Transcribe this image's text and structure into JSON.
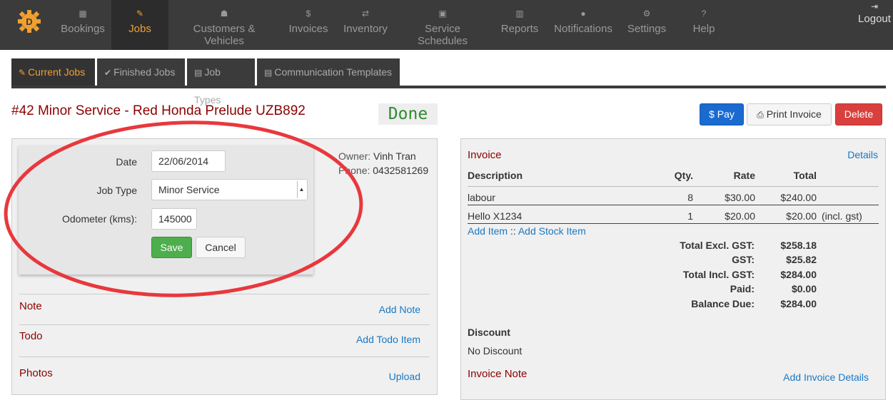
{
  "nav": {
    "items": [
      {
        "label": "Bookings",
        "icon": "calendar-icon",
        "glyph": "▦"
      },
      {
        "label": "Jobs",
        "icon": "wrench-icon",
        "glyph": "✎"
      },
      {
        "label": "Customers & Vehicles",
        "icon": "users-icon",
        "glyph": "☗"
      },
      {
        "label": "Invoices",
        "icon": "dollar-icon",
        "glyph": "$"
      },
      {
        "label": "Inventory",
        "icon": "exchange-icon",
        "glyph": "⇄"
      },
      {
        "label": "Service Schedules",
        "icon": "calendar-small-icon",
        "glyph": "▣"
      },
      {
        "label": "Reports",
        "icon": "bar-chart-icon",
        "glyph": "▥"
      },
      {
        "label": "Notifications",
        "icon": "info-icon",
        "glyph": "●"
      },
      {
        "label": "Settings",
        "icon": "cogs-icon",
        "glyph": "⚙"
      },
      {
        "label": "Help",
        "icon": "question-icon",
        "glyph": "?"
      }
    ],
    "logout": {
      "label": "Logout",
      "glyph": "⇥"
    },
    "active_color": "#f0a030"
  },
  "tabs": [
    {
      "label": "Current Jobs",
      "glyph": "✎"
    },
    {
      "label": "Finished Jobs",
      "glyph": "✔"
    },
    {
      "label": "Job Types",
      "glyph": "▤"
    },
    {
      "label": "Communication Templates",
      "glyph": "▤"
    }
  ],
  "job": {
    "title": "#42 Minor Service - Red Honda Prelude UZB892",
    "status": "Done"
  },
  "actions": {
    "pay": "$ Pay",
    "print": "Print Invoice",
    "delete": "Delete"
  },
  "form": {
    "date_label": "Date",
    "date_value": "22/06/2014",
    "job_type_label": "Job Type",
    "job_type_value": "Minor Service",
    "odometer_label": "Odometer (kms):",
    "odometer_value": "145000",
    "save": "Save",
    "cancel": "Cancel"
  },
  "owner": {
    "owner_key": "Owner:",
    "owner_name": "Vinh Tran",
    "phone_key": "Phone:",
    "phone": "0432581269"
  },
  "sections": {
    "note": "Note",
    "note_link": "Add Note",
    "todo": "Todo",
    "todo_link": "Add Todo Item",
    "photos": "Photos",
    "photos_link": "Upload"
  },
  "invoice": {
    "title": "Invoice",
    "details_link": "Details",
    "headers": {
      "description": "Description",
      "qty": "Qty.",
      "rate": "Rate",
      "total": "Total"
    },
    "rows": [
      {
        "description": "labour",
        "qty": "8",
        "rate": "$30.00",
        "total": "$240.00",
        "note": ""
      },
      {
        "description": "Hello X1234",
        "qty": "1",
        "rate": "$20.00",
        "total": "$20.00",
        "note": "(incl. gst)"
      }
    ],
    "add_item": "Add Item",
    "separator": "::",
    "add_stock_item": "Add Stock Item",
    "totals": [
      {
        "label": "Total Excl. GST:",
        "value": "$258.18"
      },
      {
        "label": "GST:",
        "value": "$25.82"
      },
      {
        "label": "Total Incl. GST:",
        "value": "$284.00"
      },
      {
        "label": "Paid:",
        "value": "$0.00"
      },
      {
        "label": "Balance Due:",
        "value": "$284.00"
      }
    ],
    "discount_label": "Discount",
    "discount_value": "No Discount",
    "invoice_note_label": "Invoice Note",
    "invoice_note_link": "Add Invoice Details"
  }
}
